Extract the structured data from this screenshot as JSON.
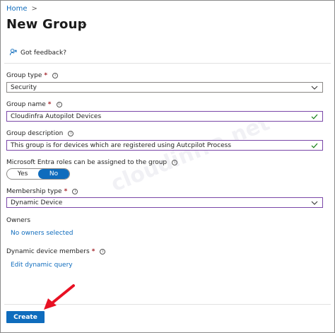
{
  "breadcrumb": {
    "home": "Home",
    "separator": ">"
  },
  "page": {
    "title": "New Group",
    "more": "···"
  },
  "feedback": {
    "label": "Got feedback?"
  },
  "form": {
    "group_type": {
      "label": "Group type",
      "required": "*",
      "value": "Security"
    },
    "group_name": {
      "label": "Group name",
      "required": "*",
      "value": "Cloudinfra Autopilot Devices"
    },
    "group_description": {
      "label": "Group description",
      "value": "This group is for devices which are registered using Autcpilot Process"
    },
    "entra_roles": {
      "label": "Microsoft Entra roles can be assigned to the group",
      "yes": "Yes",
      "no": "No",
      "selected": "No"
    },
    "membership_type": {
      "label": "Membership type",
      "required": "*",
      "value": "Dynamic Device"
    },
    "owners": {
      "label": "Owners",
      "link": "No owners selected"
    },
    "dynamic_members": {
      "label": "Dynamic device members",
      "required": "*",
      "link": "Edit dynamic query"
    }
  },
  "actions": {
    "create": "Create"
  },
  "watermark": "cloudinfra.net",
  "colors": {
    "accent": "#0f6cbd",
    "valid_border": "#7a47a8",
    "check": "#107c10",
    "arrow": "#e81123"
  },
  "icons": [
    "chevron-right-icon",
    "feedback-icon",
    "info-icon",
    "chevron-down-icon",
    "checkmark-icon",
    "red-arrow-icon"
  ]
}
